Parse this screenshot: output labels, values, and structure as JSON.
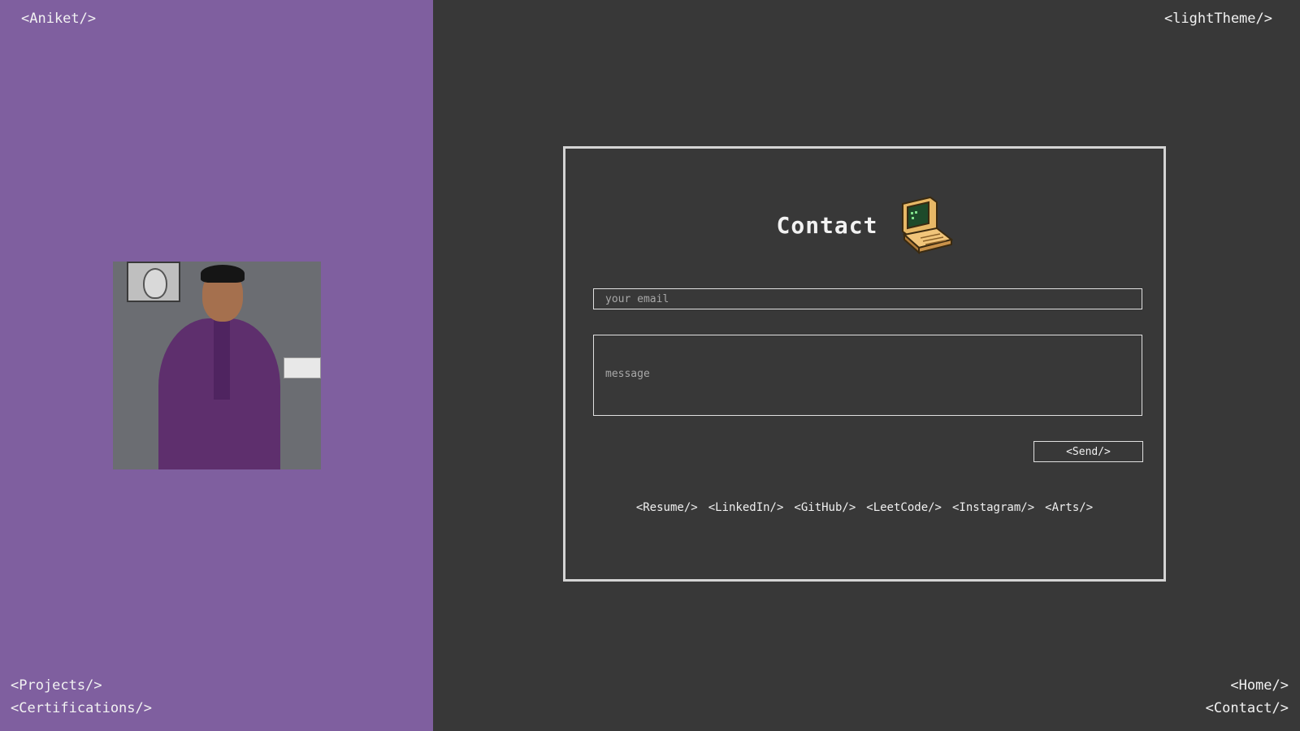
{
  "header": {
    "brand": "<Aniket/>",
    "theme_toggle": "<lightTheme/>"
  },
  "nav_left": {
    "projects": "<Projects/>",
    "certifications": "<Certifications/>"
  },
  "nav_right": {
    "home": "<Home/>",
    "contact": "<Contact/>"
  },
  "contact_card": {
    "title": "Contact",
    "icon": "retro-computer-icon",
    "email_placeholder": "your email",
    "message_placeholder": "message",
    "send_label": "<Send/>",
    "links": [
      "<Resume/>",
      "<LinkedIn/>",
      "<GitHub/>",
      "<LeetCode/>",
      "<Instagram/>",
      "<Arts/>"
    ]
  },
  "colors": {
    "left_panel": "#7f5f9f",
    "right_panel": "#383838",
    "text": "#f2f2f2",
    "border": "#d4d4d4"
  }
}
